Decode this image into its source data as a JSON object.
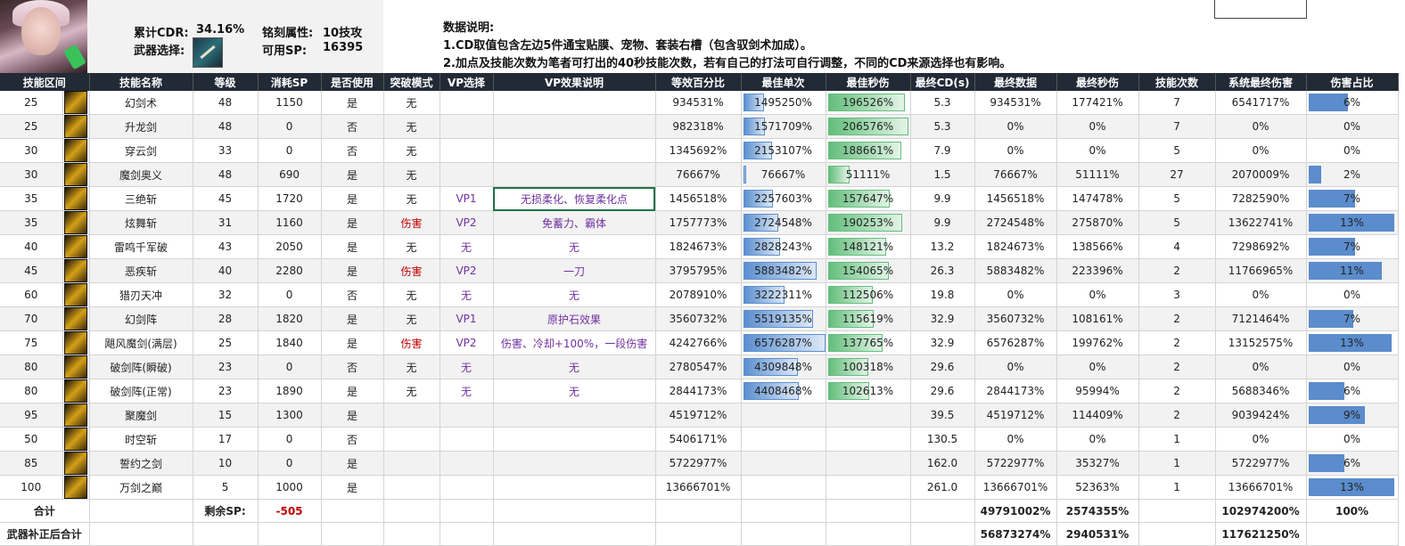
{
  "header": {
    "cdr_label": "累计CDR:",
    "cdr_value": "34.16%",
    "weapon_label": "武器选择:",
    "inscription_label": "铭刻属性:",
    "inscription_value": "10技攻",
    "sp_label": "可用SP:",
    "sp_value": "16395",
    "notes_title": "数据说明:",
    "note1": "1.CD取值包含左边5件通宝贴膜、宠物、套装右槽（包含驭剑术加成）。",
    "note2": "2.加点及技能次数为笔者可打出的40秒技能次数，若有自己的打法可自行调整，不同的CD来源选择也有影响。"
  },
  "columns": [
    "技能区间",
    "技能名称",
    "等级",
    "消耗SP",
    "是否使用",
    "突破模式",
    "VP选择",
    "VP效果说明",
    "等效百分比",
    "最佳单次",
    "最佳秒伤",
    "最终CD(s)",
    "最终数据",
    "最终秒伤",
    "技能次数",
    "系统最终伤害",
    "伤害占比"
  ],
  "rows": [
    {
      "range": "25",
      "name": "幻剑术",
      "level": "48",
      "sp": "1150",
      "use": "是",
      "mode": "无",
      "vp": "",
      "vpdesc": "",
      "eq": "934531%",
      "single": "1495250%",
      "single_frac": 0.23,
      "dps": "196526%",
      "dps_frac": 0.95,
      "cd": "5.3",
      "final": "934531%",
      "fdps": "177421%",
      "count": "7",
      "sys": "6541717%",
      "share": "6%",
      "share_frac": 0.46
    },
    {
      "range": "25",
      "name": "升龙剑",
      "level": "48",
      "sp": "0",
      "use": "否",
      "mode": "无",
      "vp": "",
      "vpdesc": "",
      "eq": "982318%",
      "single": "1571709%",
      "single_frac": 0.24,
      "dps": "206576%",
      "dps_frac": 1.0,
      "cd": "5.3",
      "final": "0%",
      "fdps": "0%",
      "count": "7",
      "sys": "0%",
      "share": "0%",
      "share_frac": 0
    },
    {
      "range": "30",
      "name": "穿云剑",
      "level": "33",
      "sp": "0",
      "use": "否",
      "mode": "无",
      "vp": "",
      "vpdesc": "",
      "eq": "1345692%",
      "single": "2153107%",
      "single_frac": 0.33,
      "dps": "188661%",
      "dps_frac": 0.91,
      "cd": "7.9",
      "final": "0%",
      "fdps": "0%",
      "count": "5",
      "sys": "0%",
      "share": "0%",
      "share_frac": 0
    },
    {
      "range": "30",
      "name": "魔剑奥义",
      "level": "48",
      "sp": "690",
      "use": "是",
      "mode": "无",
      "vp": "",
      "vpdesc": "",
      "eq": "76667%",
      "single": "76667%",
      "single_frac": 0.01,
      "dps": "51111%",
      "dps_frac": 0.25,
      "cd": "1.5",
      "final": "76667%",
      "fdps": "51111%",
      "count": "27",
      "sys": "2070009%",
      "share": "2%",
      "share_frac": 0.15
    },
    {
      "range": "35",
      "name": "三绝斩",
      "level": "45",
      "sp": "1720",
      "use": "是",
      "mode": "无",
      "vp": "VP1",
      "vpdesc": "无损柔化、恢复柔化点",
      "eq": "1456518%",
      "single": "2257603%",
      "single_frac": 0.34,
      "dps": "157647%",
      "dps_frac": 0.76,
      "cd": "9.9",
      "final": "1456518%",
      "fdps": "147478%",
      "count": "5",
      "sys": "7282590%",
      "share": "7%",
      "share_frac": 0.54
    },
    {
      "range": "35",
      "name": "炫舞斩",
      "level": "31",
      "sp": "1160",
      "use": "是",
      "mode": "伤害",
      "vp": "VP2",
      "vpdesc": "免蓄力、霸体",
      "eq": "1757773%",
      "single": "2724548%",
      "single_frac": 0.41,
      "dps": "190253%",
      "dps_frac": 0.92,
      "cd": "9.9",
      "final": "2724548%",
      "fdps": "275870%",
      "count": "5",
      "sys": "13622741%",
      "share": "13%",
      "share_frac": 1.0
    },
    {
      "range": "40",
      "name": "雷鸣千军破",
      "level": "43",
      "sp": "2050",
      "use": "是",
      "mode": "无",
      "vp": "无",
      "vpdesc": "无",
      "eq": "1824673%",
      "single": "2828243%",
      "single_frac": 0.43,
      "dps": "148121%",
      "dps_frac": 0.72,
      "cd": "13.2",
      "final": "1824673%",
      "fdps": "138566%",
      "count": "4",
      "sys": "7298692%",
      "share": "7%",
      "share_frac": 0.54
    },
    {
      "range": "45",
      "name": "恶疾斩",
      "level": "40",
      "sp": "2280",
      "use": "是",
      "mode": "伤害",
      "vp": "VP2",
      "vpdesc": "一刀",
      "eq": "3795795%",
      "single": "5883482%",
      "single_frac": 0.89,
      "dps": "154065%",
      "dps_frac": 0.75,
      "cd": "26.3",
      "final": "5883482%",
      "fdps": "223396%",
      "count": "2",
      "sys": "11766965%",
      "share": "11%",
      "share_frac": 0.85
    },
    {
      "range": "60",
      "name": "猎刃天冲",
      "level": "32",
      "sp": "0",
      "use": "否",
      "mode": "无",
      "vp": "无",
      "vpdesc": "无",
      "eq": "2078910%",
      "single": "3222311%",
      "single_frac": 0.49,
      "dps": "112506%",
      "dps_frac": 0.54,
      "cd": "19.8",
      "final": "0%",
      "fdps": "0%",
      "count": "3",
      "sys": "0%",
      "share": "0%",
      "share_frac": 0
    },
    {
      "range": "70",
      "name": "幻剑阵",
      "level": "28",
      "sp": "1820",
      "use": "是",
      "mode": "无",
      "vp": "VP1",
      "vpdesc": "原护石效果",
      "eq": "3560732%",
      "single": "5519135%",
      "single_frac": 0.84,
      "dps": "115619%",
      "dps_frac": 0.56,
      "cd": "32.9",
      "final": "3560732%",
      "fdps": "108161%",
      "count": "2",
      "sys": "7121464%",
      "share": "7%",
      "share_frac": 0.52
    },
    {
      "range": "75",
      "name": "飓风魔剑(满层)",
      "level": "25",
      "sp": "1840",
      "use": "是",
      "mode": "伤害",
      "vp": "VP2",
      "vpdesc": "伤害、冷却+100%，一段伤害",
      "eq": "4242766%",
      "single": "6576287%",
      "single_frac": 1.0,
      "dps": "137765%",
      "dps_frac": 0.67,
      "cd": "32.9",
      "final": "6576287%",
      "fdps": "199762%",
      "count": "2",
      "sys": "13152575%",
      "share": "13%",
      "share_frac": 0.97
    },
    {
      "range": "80",
      "name": "破剑阵(瞬破)",
      "level": "23",
      "sp": "0",
      "use": "否",
      "mode": "无",
      "vp": "无",
      "vpdesc": "无",
      "eq": "2780547%",
      "single": "4309848%",
      "single_frac": 0.66,
      "dps": "100318%",
      "dps_frac": 0.49,
      "cd": "29.6",
      "final": "0%",
      "fdps": "0%",
      "count": "2",
      "sys": "0%",
      "share": "0%",
      "share_frac": 0
    },
    {
      "range": "80",
      "name": "破剑阵(正常)",
      "level": "23",
      "sp": "1890",
      "use": "是",
      "mode": "无",
      "vp": "无",
      "vpdesc": "无",
      "eq": "2844173%",
      "single": "4408468%",
      "single_frac": 0.67,
      "dps": "102613%",
      "dps_frac": 0.5,
      "cd": "29.6",
      "final": "2844173%",
      "fdps": "95994%",
      "count": "2",
      "sys": "5688346%",
      "share": "6%",
      "share_frac": 0.42
    },
    {
      "range": "95",
      "name": "聚魔剑",
      "level": "15",
      "sp": "1300",
      "use": "是",
      "mode": "",
      "vp": "",
      "vpdesc": "",
      "eq": "4519712%",
      "single": "",
      "single_frac": 0,
      "dps": "",
      "dps_frac": 0,
      "cd": "39.5",
      "final": "4519712%",
      "fdps": "114409%",
      "count": "2",
      "sys": "9039424%",
      "share": "9%",
      "share_frac": 0.66
    },
    {
      "range": "50",
      "name": "时空斩",
      "level": "17",
      "sp": "0",
      "use": "否",
      "mode": "",
      "vp": "",
      "vpdesc": "",
      "eq": "5406171%",
      "single": "",
      "single_frac": 0,
      "dps": "",
      "dps_frac": 0,
      "cd": "130.5",
      "final": "0%",
      "fdps": "0%",
      "count": "1",
      "sys": "0%",
      "share": "0%",
      "share_frac": 0
    },
    {
      "range": "85",
      "name": "誓约之剑",
      "level": "10",
      "sp": "0",
      "use": "是",
      "mode": "",
      "vp": "",
      "vpdesc": "",
      "eq": "5722977%",
      "single": "",
      "single_frac": 0,
      "dps": "",
      "dps_frac": 0,
      "cd": "162.0",
      "final": "5722977%",
      "fdps": "35327%",
      "count": "1",
      "sys": "5722977%",
      "share": "6%",
      "share_frac": 0.42
    },
    {
      "range": "100",
      "name": "万剑之巅",
      "level": "5",
      "sp": "1000",
      "use": "是",
      "mode": "",
      "vp": "",
      "vpdesc": "",
      "eq": "13666701%",
      "single": "",
      "single_frac": 0,
      "dps": "",
      "dps_frac": 0,
      "cd": "261.0",
      "final": "13666701%",
      "fdps": "52363%",
      "count": "1",
      "sys": "13666701%",
      "share": "13%",
      "share_frac": 1.0
    }
  ],
  "total": {
    "label": "合计",
    "remain_label": "剩余SP:",
    "remain_value": "-505",
    "final": "49791002%",
    "fdps": "2574355%",
    "sys": "102974200%",
    "share": "100%"
  },
  "weapon_total": {
    "label": "武器补正后合计",
    "final": "56873274%",
    "fdps": "2940531%",
    "sys": "117621250%"
  }
}
